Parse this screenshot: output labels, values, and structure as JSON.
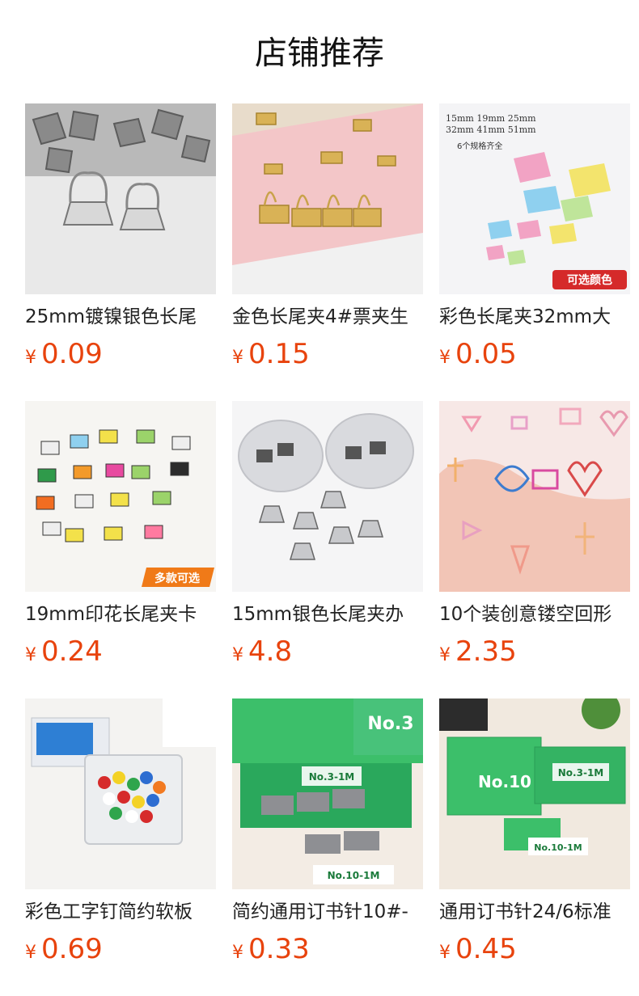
{
  "header": {
    "title": "店铺推荐"
  },
  "products": [
    {
      "name": "25mm镀镍银色长尾",
      "currency": "¥",
      "price": "0.09",
      "image": "silver-binder-clips-photo"
    },
    {
      "name": "金色长尾夹4#票夹生",
      "currency": "¥",
      "price": "0.15",
      "image": "gold-binder-clips-photo"
    },
    {
      "name": "彩色长尾夹32mm大",
      "currency": "¥",
      "price": "0.05",
      "image": "color-binder-clips-photo",
      "overlay": {
        "sizes_line1": "15mm  19mm  25mm",
        "sizes_line2": "32mm  41mm  51mm",
        "note": "6个规格齐全",
        "badge": "可选颜色"
      }
    },
    {
      "name": "19mm印花长尾夹卡",
      "currency": "¥",
      "price": "0.24",
      "image": "printed-binder-clips-photo",
      "overlay": {
        "badge": "多款可选"
      }
    },
    {
      "name": "15mm银色长尾夹办",
      "currency": "¥",
      "price": "4.8",
      "image": "boxed-silver-clips-photo"
    },
    {
      "name": "10个装创意镂空回形",
      "currency": "¥",
      "price": "2.35",
      "image": "shaped-paper-clips-photo"
    },
    {
      "name": "彩色工字钉简约软板",
      "currency": "¥",
      "price": "0.69",
      "image": "push-pins-photo"
    },
    {
      "name": "简约通用订书针10#-",
      "currency": "¥",
      "price": "0.33",
      "image": "staples-box-photo",
      "overlay": {
        "box_label": "No.3",
        "small_box_label": "No.10-1M",
        "box_label2": "No.3-1M"
      }
    },
    {
      "name": "通用订书针24/6标准",
      "currency": "¥",
      "price": "0.45",
      "image": "green-staples-box-photo",
      "overlay": {
        "box_label": "No.10",
        "box_label2": "No.3-1M",
        "small_box_label": "No.10-1M"
      }
    }
  ]
}
